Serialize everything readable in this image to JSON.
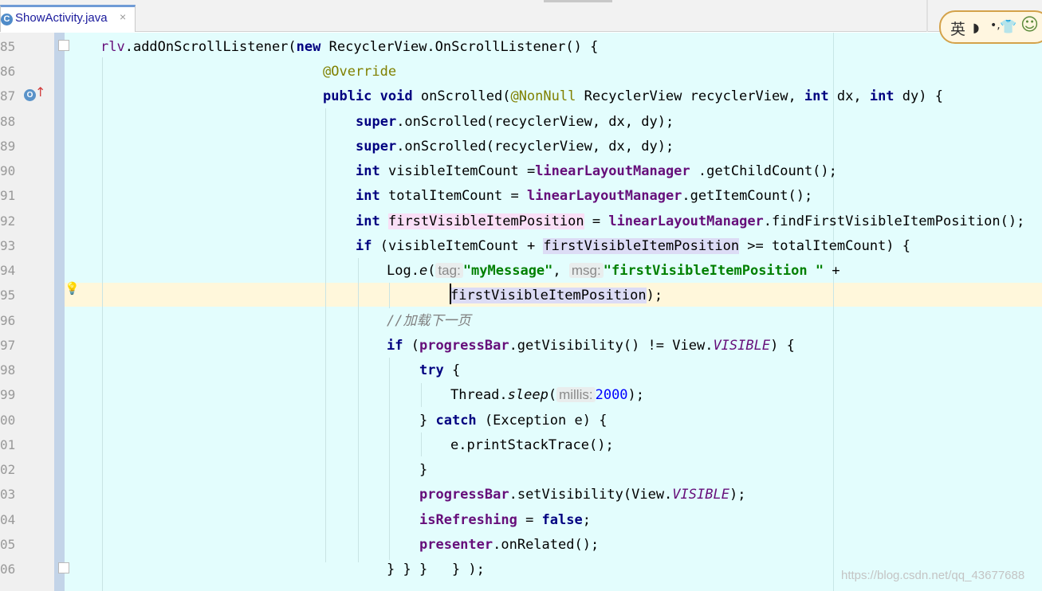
{
  "tab": {
    "icon_letter": "C",
    "label": "ShowActivity.java",
    "close": "×"
  },
  "ime": {
    "label": "英",
    "moon": "◗",
    "dots": "•,",
    "shirt": "👕",
    "face": "☺"
  },
  "gutter": {
    "line_numbers": [
      "85",
      "86",
      "87",
      "88",
      "89",
      "90",
      "91",
      "92",
      "93",
      "94",
      "95",
      "96",
      "97",
      "98",
      "99",
      "00",
      "01",
      "02",
      "03",
      "04",
      "05",
      "06"
    ],
    "override_icon_letter": "O",
    "override_arrow": "↑",
    "bulb": "💡"
  },
  "code": {
    "l85_rlv": "rlv",
    "l85_a": ".addOnScrollListener(",
    "l85_new": "new",
    "l85_b": " RecyclerView.OnScrollListener() {",
    "l86_ann": "@Override",
    "l87_public": "public",
    "l87_void": "void",
    "l87_a": " onScrolled(",
    "l87_ann": "@NonNull",
    "l87_b": " RecyclerView recyclerView, ",
    "l87_int1": "int",
    "l87_c": " dx, ",
    "l87_int2": "int",
    "l87_d": " dy) {",
    "l88_super": "super",
    "l88_a": ".onScrolled(recyclerView, dx, dy);",
    "l89_super": "super",
    "l89_a": ".onScrolled(recyclerView, dx, dy);",
    "l90_int": "int",
    "l90_a": " visibleItemCount =",
    "l90_fld": "linearLayoutManager",
    "l90_b": " .getChildCount();",
    "l91_int": "int",
    "l91_a": " totalItemCount = ",
    "l91_fld": "linearLayoutManager",
    "l91_b": ".getItemCount();",
    "l92_int": "int",
    "l92_var": "firstVisibleItemPosition",
    "l92_a": " = ",
    "l92_fld": "linearLayoutManager",
    "l92_b": ".findFirstVisibleItemPosition();",
    "l93_if": "if",
    "l93_a": " (visibleItemCount + ",
    "l93_var": "firstVisibleItemPosition",
    "l93_b": " >= totalItemCount) {",
    "l94_a": "Log.",
    "l94_e": "e",
    "l94_b": "(",
    "l94_hint1": "tag:",
    "l94_str1": "\"myMessage\"",
    "l94_c": ", ",
    "l94_hint2": "msg:",
    "l94_str2": "\"firstVisibleItemPosition \"",
    "l94_d": " +",
    "l95_var": "firstVisibleItemPosition",
    "l95_a": ");",
    "l96_cmt": "//加载下一页",
    "l97_if": "if",
    "l97_a": " (",
    "l97_fld": "progressBar",
    "l97_b": ".getVisibility() != View.",
    "l97_const": "VISIBLE",
    "l97_c": ") {",
    "l98_try": "try",
    "l98_a": " {",
    "l99_a": "Thread.",
    "l99_sleep": "sleep",
    "l99_b": "(",
    "l99_hint": "millis:",
    "l99_num": "2000",
    "l99_c": ");",
    "l100_a": "} ",
    "l100_catch": "catch",
    "l100_b": " (Exception e) {",
    "l101_a": "e.printStackTrace();",
    "l102_a": "}",
    "l103_fld": "progressBar",
    "l103_a": ".setVisibility(View.",
    "l103_const": "VISIBLE",
    "l103_b": ");",
    "l104_fld": "isRefreshing",
    "l104_a": " = ",
    "l104_false": "false",
    "l104_b": ";",
    "l105_fld": "presenter",
    "l105_a": ".onRelated();",
    "l106_a": "} } }   } );"
  },
  "watermark": "https://blog.csdn.net/qq_43677688"
}
